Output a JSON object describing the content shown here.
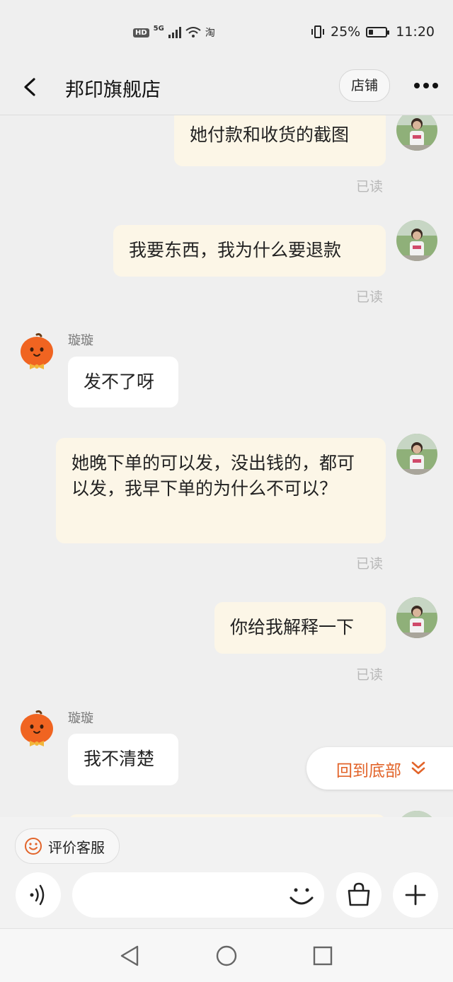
{
  "status_bar": {
    "network": "5G",
    "hd": "HD",
    "carrier_icon": "淘",
    "battery_percent": "25%",
    "battery_level": 0.25,
    "time": "11:20"
  },
  "header": {
    "title": "邦印旗舰店",
    "store_button": "店铺",
    "icons": {
      "back": "chevron-left-icon",
      "more": "more-dots-icon"
    }
  },
  "messages": [
    {
      "side": "mine",
      "text": "她付款和收货的截图",
      "status": "已读"
    },
    {
      "side": "mine",
      "text": "我要东西，我为什么要退款",
      "status": "已读"
    },
    {
      "side": "theirs",
      "sender": "璇璇",
      "text": "发不了呀"
    },
    {
      "side": "mine",
      "text": "她晚下单的可以发，没出钱的，都可以发，我早下单的为什么不可以？",
      "status": "已读"
    },
    {
      "side": "mine",
      "text": "你给我解释一下",
      "status": "已读"
    },
    {
      "side": "theirs",
      "sender": "璇璇",
      "text": "我不清楚"
    }
  ],
  "back_to_bottom": "回到底部",
  "bottom": {
    "rate_button": "评价客服",
    "input_placeholder": ""
  },
  "colors": {
    "accent": "#e2642a",
    "my_bubble": "#fcf6e7",
    "their_bubble": "#ffffff",
    "background": "#efefef"
  }
}
